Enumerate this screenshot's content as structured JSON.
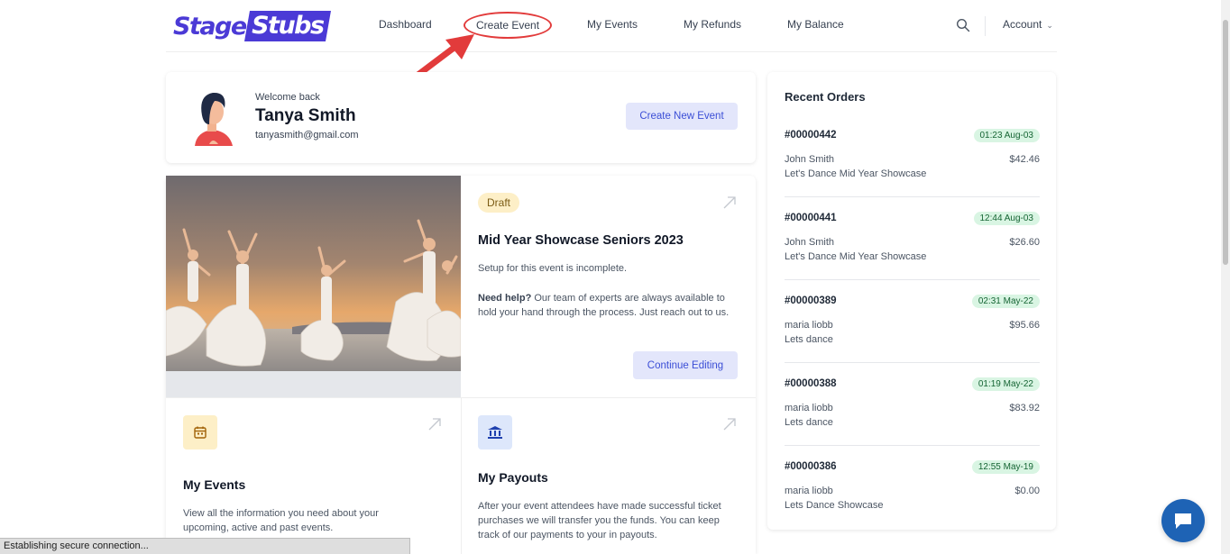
{
  "header": {
    "logo_part1": "Stage",
    "logo_part2": "Stubs",
    "nav": [
      "Dashboard",
      "Create Event",
      "My Events",
      "My Refunds",
      "My Balance"
    ],
    "account_label": "Account"
  },
  "welcome": {
    "greeting": "Welcome back",
    "name": "Tanya Smith",
    "email": "tanyasmith@gmail.com",
    "create_button": "Create New Event"
  },
  "event": {
    "badge": "Draft",
    "title": "Mid Year Showcase Seniors 2023",
    "status": "Setup for this event is incomplete.",
    "help_bold": "Need help?",
    "help_text": " Our team of experts are always available to hold your hand through the process. Just reach out to us.",
    "continue_button": "Continue Editing"
  },
  "tiles": [
    {
      "title": "My Events",
      "text": "View all the information you need about your upcoming, active and past events.",
      "icon": "calendar-icon",
      "icon_bg": "#fdefc7",
      "icon_color": "#a16207"
    },
    {
      "title": "My Payouts",
      "text": "After your event attendees have made successful ticket purchases we will transfer you the funds. You can keep track of our payments to your in payouts.",
      "icon": "bank-icon",
      "icon_bg": "#dde7fb",
      "icon_color": "#1e40af"
    }
  ],
  "orders": {
    "title": "Recent Orders",
    "items": [
      {
        "id": "#00000442",
        "time": "01:23 Aug-03",
        "customer": "John Smith",
        "amount": "$42.46",
        "event": "Let's Dance Mid Year Showcase"
      },
      {
        "id": "#00000441",
        "time": "12:44 Aug-03",
        "customer": "John Smith",
        "amount": "$26.60",
        "event": "Let's Dance Mid Year Showcase"
      },
      {
        "id": "#00000389",
        "time": "02:31 May-22",
        "customer": "maria liobb",
        "amount": "$95.66",
        "event": "Lets dance"
      },
      {
        "id": "#00000388",
        "time": "01:19 May-22",
        "customer": "maria liobb",
        "amount": "$83.92",
        "event": "Lets dance"
      },
      {
        "id": "#00000386",
        "time": "12:55 May-19",
        "customer": "maria liobb",
        "amount": "$0.00",
        "event": "Lets Dance Showcase"
      }
    ]
  },
  "status_bar": "Establishing secure connection...",
  "colors": {
    "brand": "#4b3ad6",
    "annotation": "#e23b3b",
    "chat": "#1e63b5"
  }
}
